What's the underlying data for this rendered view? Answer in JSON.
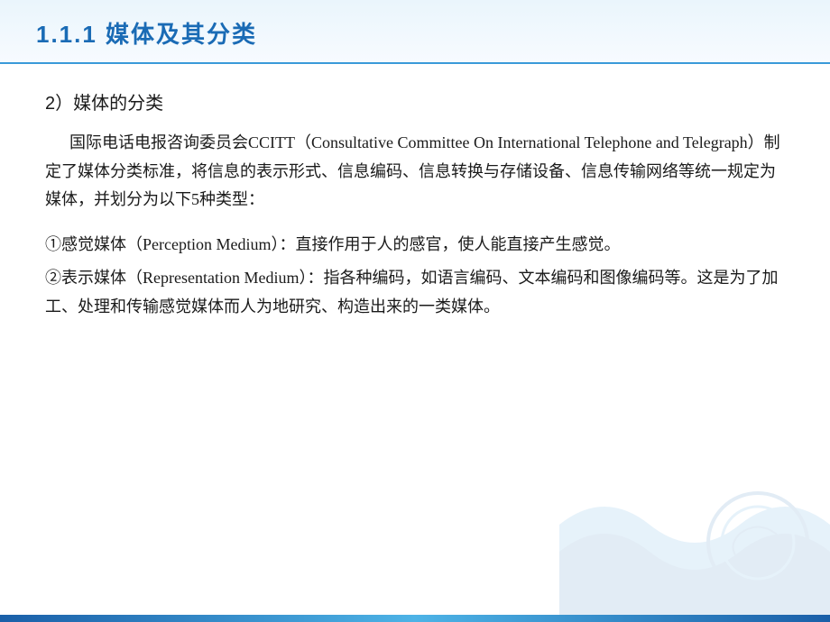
{
  "slide": {
    "title": "1.1.1   媒体及其分类",
    "colors": {
      "title": "#1a6bb5",
      "accent": "#3a9ad9",
      "text": "#1a1a1a",
      "bg_top": "#eaf5fc"
    },
    "subtitle": "2）媒体的分类",
    "paragraph1_indent": "　　",
    "paragraph1": "国际电话电报咨询委员会CCITT（Consultative Committee On International Telephone and Telegraph）制定了媒体分类标准，将信息的表示形式、信息编码、信息转换与存储设备、信息传输网络等统一规定为媒体，并划分为以下5种类型：",
    "items": [
      {
        "id": "item1",
        "text": "①感觉媒体（Perception Medium）：直接作用于人的感官，使人能直接产生感觉。"
      },
      {
        "id": "item2",
        "text": "②表示媒体（Representation Medium）：指各种编码，如语言编码、文本编码和图像编码等。这是为了加工、处理和传输感觉媒体而人为地研究、构造出来的一类媒体。"
      }
    ]
  }
}
